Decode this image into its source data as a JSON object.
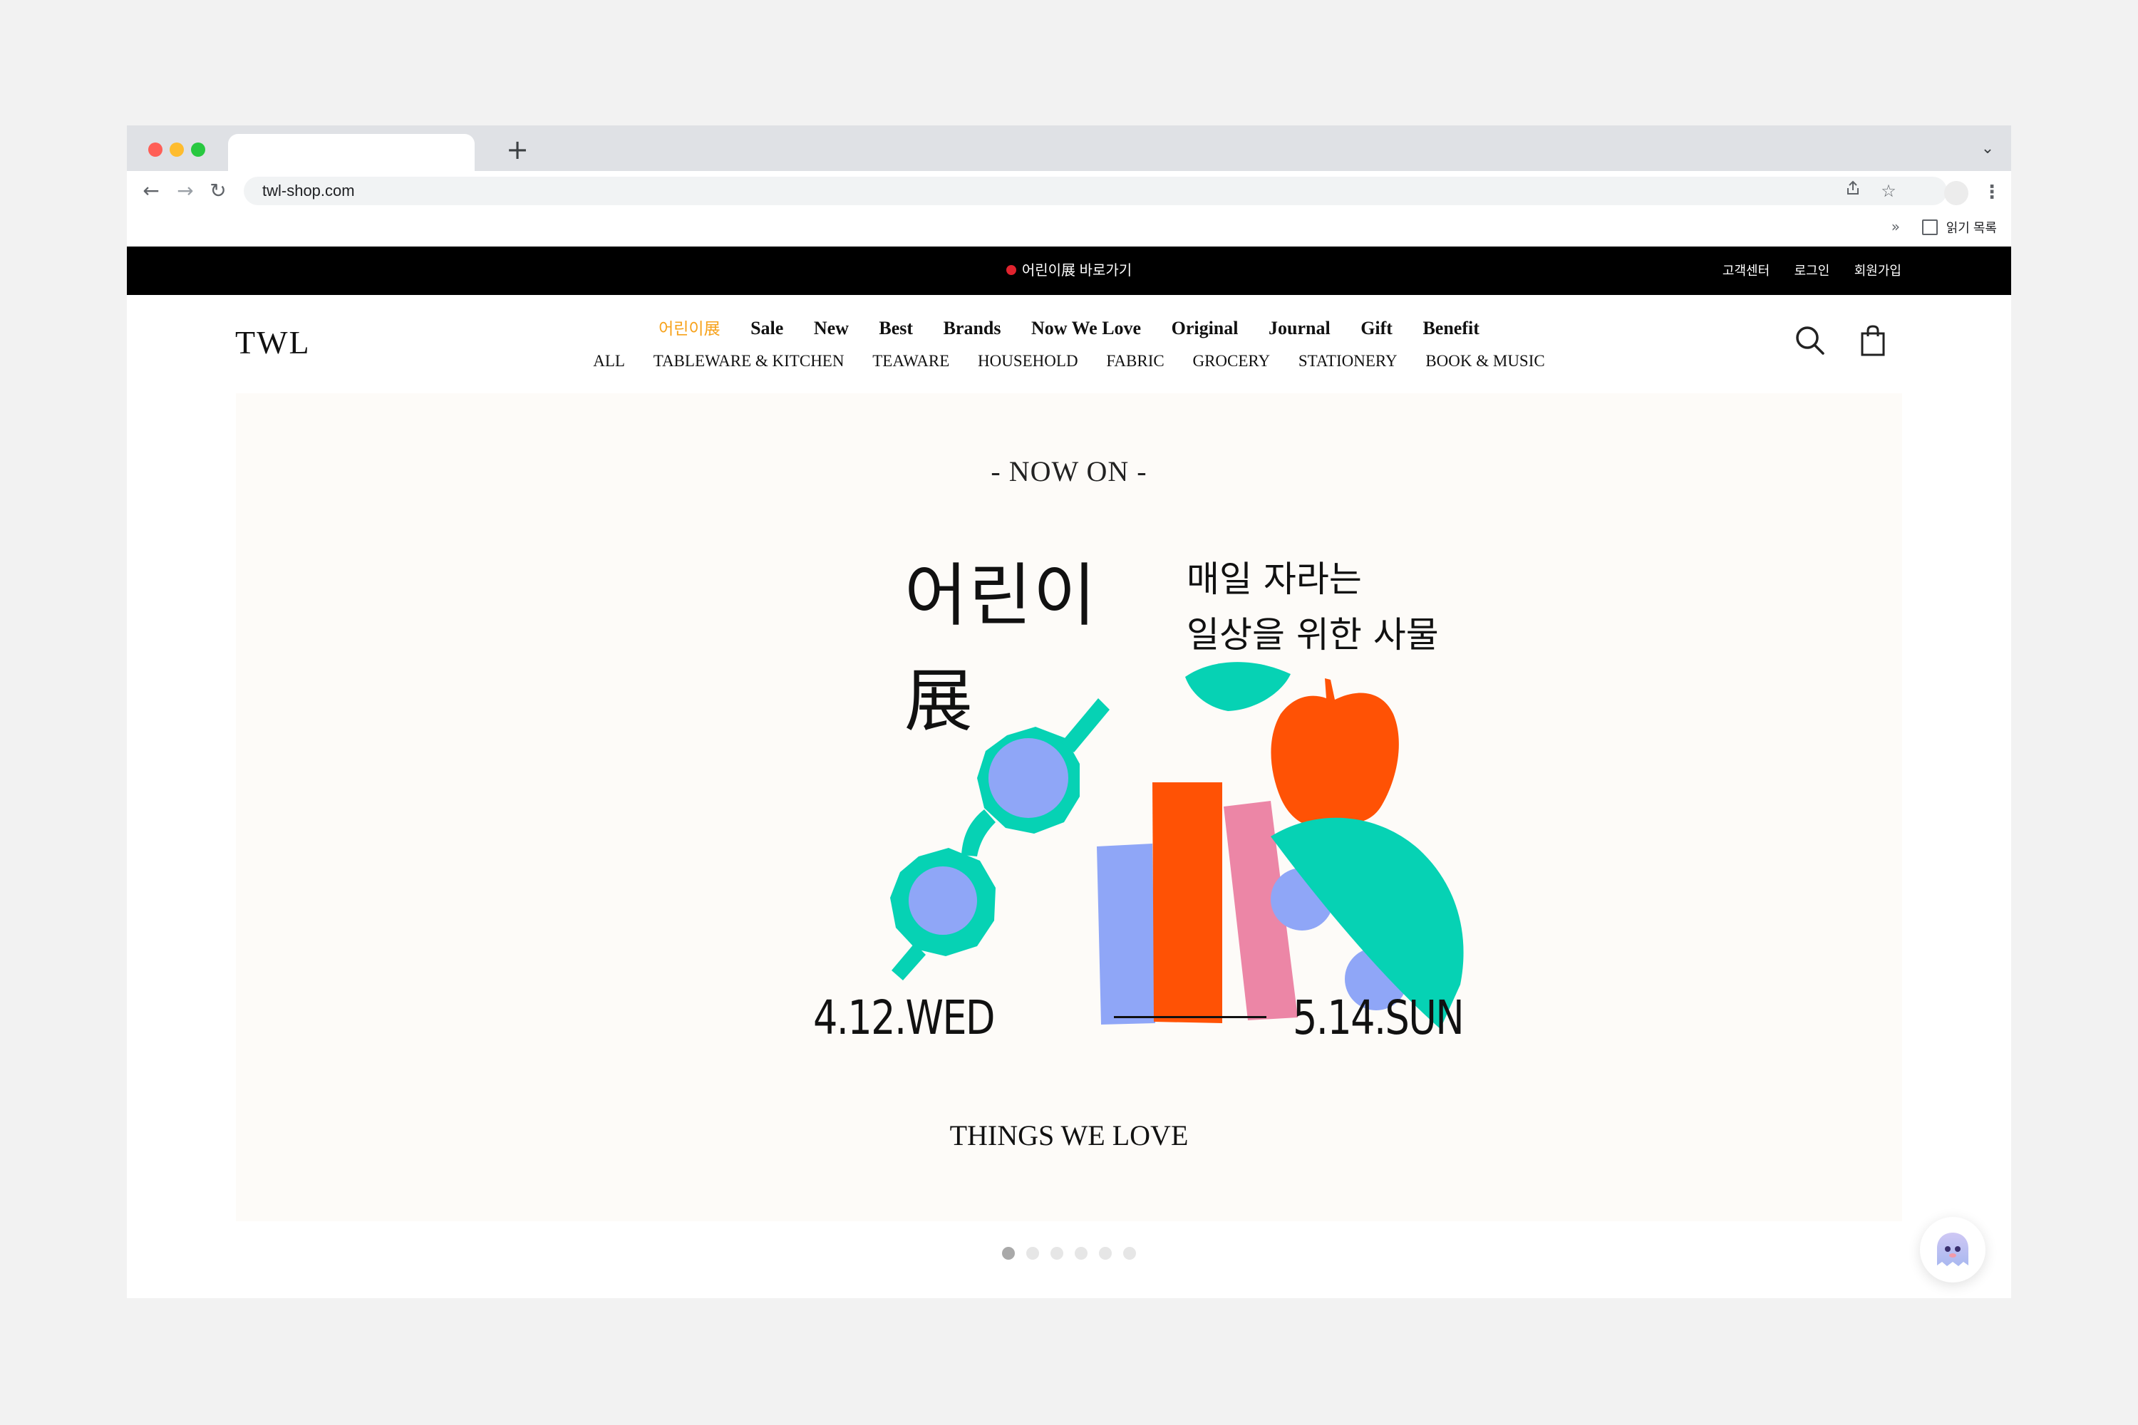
{
  "browser": {
    "url": "twl-shop.com",
    "reading_list_label": "읽기 목록",
    "bookmark_chevron": "»"
  },
  "promo_bar": {
    "center_text": "어린이展 바로가기",
    "links": [
      "고객센터",
      "로그인",
      "회원가입"
    ],
    "dot_color": "#e0232e"
  },
  "header": {
    "logo": "TWL",
    "main_nav": [
      {
        "label": "어린이展",
        "highlight": true
      },
      {
        "label": "Sale"
      },
      {
        "label": "New"
      },
      {
        "label": "Best"
      },
      {
        "label": "Brands"
      },
      {
        "label": "Now We Love"
      },
      {
        "label": "Original"
      },
      {
        "label": "Journal"
      },
      {
        "label": "Gift"
      },
      {
        "label": "Benefit"
      }
    ],
    "sub_nav": [
      "ALL",
      "TABLEWARE & KITCHEN",
      "TEAWARE",
      "HOUSEHOLD",
      "FABRIC",
      "GROCERY",
      "STATIONERY",
      "BOOK & MUSIC"
    ],
    "icons": [
      "search-icon",
      "shopping-bag-icon"
    ]
  },
  "banner": {
    "kicker": "- NOW ON -",
    "title_line1": "어린이",
    "title_line2": "展",
    "subtitle_line1": "매일 자라는",
    "subtitle_line2": "일상을 위한 사물",
    "date_start": "4.12.WED",
    "date_end": "5.14.SUN",
    "footer": "THINGS WE LOVE",
    "colors": {
      "teal": "#06d2b4",
      "periwinkle": "#8fa6f7",
      "orange": "#ff5205",
      "pink": "#ec86a6",
      "background": "#fdfbf8"
    }
  },
  "carousel": {
    "total": 6,
    "active_index": 0
  },
  "colors": {
    "highlight_nav": "#f7a21b",
    "promo_bg": "#000000"
  }
}
